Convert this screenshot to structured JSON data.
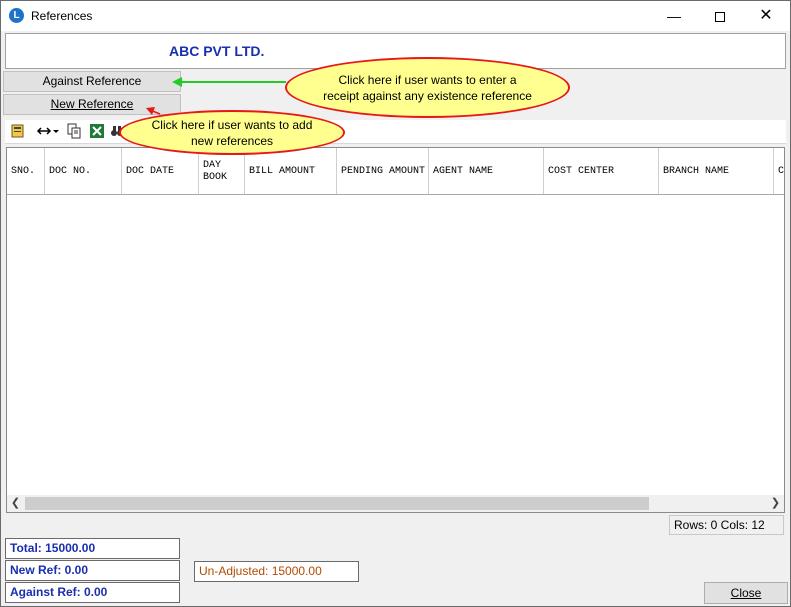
{
  "window": {
    "title": "References",
    "min_glyph": "—",
    "close_glyph": "✕"
  },
  "company": {
    "name": "ABC PVT LTD."
  },
  "buttons": {
    "against_reference": "Against Reference",
    "new_reference": "New Reference",
    "close": "Close"
  },
  "toolbar": {
    "items": [
      "layout-icon",
      "column-width-icon",
      "copy-icon",
      "excel-icon",
      "find-icon"
    ]
  },
  "grid": {
    "columns": [
      "SNO.",
      "DOC NO.",
      "DOC DATE",
      "DAY BOOK",
      "BILL AMOUNT",
      "PENDING AMOUNT",
      "AGENT NAME",
      "COST CENTER",
      "BRANCH NAME",
      "C"
    ],
    "rows": []
  },
  "status": {
    "text": "Rows: 0  Cols: 12"
  },
  "summary": {
    "total": "Total: 15000.00",
    "new_ref": "New Ref: 0.00",
    "against_ref": "Against Ref: 0.00",
    "unadjusted": "Un-Adjusted: 15000.00"
  },
  "callouts": {
    "against": "Click here if user wants to enter a receipt against any existence reference",
    "new": "Click here if user wants to add new references"
  },
  "colors": {
    "callout_fill": "#ffff8f",
    "callout_border": "#e81818",
    "arrow_green": "#22cc22",
    "company_blue": "#1a2fb0",
    "unadjusted_brown": "#b34a00"
  }
}
